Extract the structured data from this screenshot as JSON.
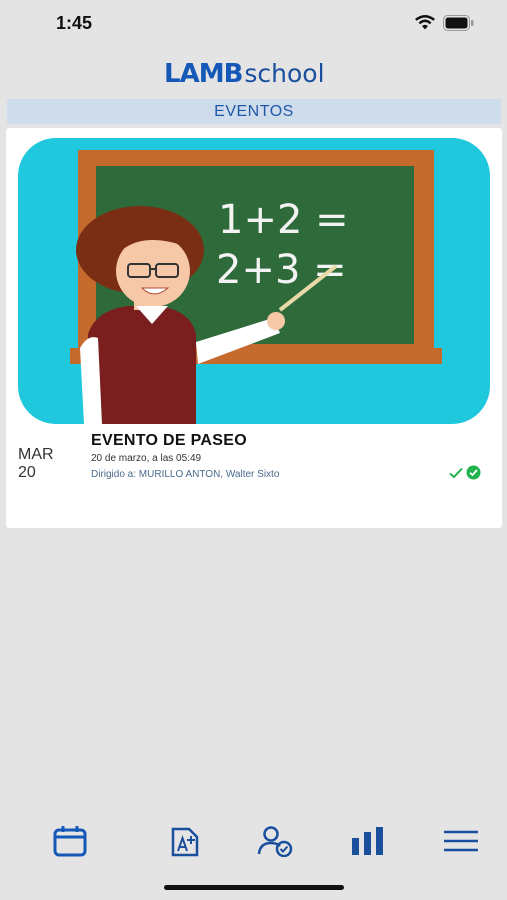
{
  "status_bar": {
    "time": "1:45"
  },
  "app": {
    "logo_lamb": "LAMB",
    "logo_school": "school"
  },
  "section": {
    "title": "EVENTOS"
  },
  "events": [
    {
      "month": "MAR",
      "day": "20",
      "title": "EVENTO DE PASEO",
      "datetime": "20 de marzo, a las 05:49",
      "target": "Dirigido a: MURILLO ANTON, Walter Sixto",
      "image_board_text": [
        "1+2 =",
        "2+3 ="
      ],
      "read_status_icons": [
        "check-icon",
        "check-circle-icon"
      ]
    }
  ],
  "tab_bar": {
    "tabs": [
      "calendar-icon",
      "grades-icon",
      "attendance-icon",
      "stats-icon",
      "menu-icon"
    ],
    "active_color": "#1558b8",
    "color": "#1a4f9e"
  },
  "colors": {
    "accent": "#1558b8",
    "header_bg": "#cfdcec",
    "success": "#22b24c"
  }
}
